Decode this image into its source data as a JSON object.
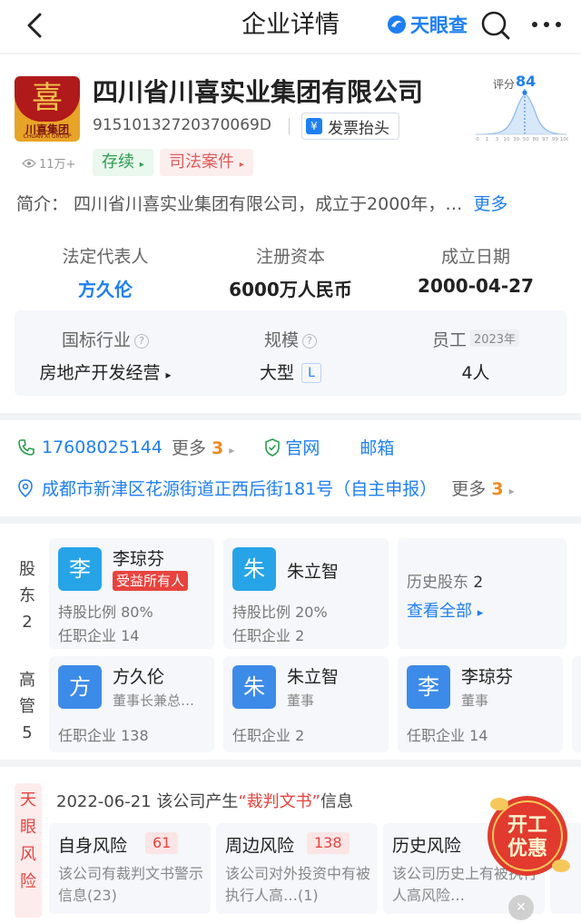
{
  "header": {
    "title": "企业详情",
    "brand": "天眼查"
  },
  "company": {
    "logo_text": "川喜集团",
    "logo_en": "CHUAN XI GROUP",
    "name": "四川省川喜实业集团有限公司",
    "credit_code": "91510132720370069D",
    "invoice_label": "发票抬头",
    "invoice_icon_glyph": "¥",
    "score_label": "评分",
    "score": 84,
    "score_axis": [
      "0",
      "1",
      "3",
      "10",
      "30",
      "50",
      "80",
      "97",
      "99",
      "100"
    ],
    "views": "11万+",
    "tags": {
      "status": "存续",
      "legal": "司法案件"
    },
    "intro_label": "简介：",
    "intro_text": "四川省川喜实业集团有限公司，成立于2000年，…",
    "intro_more": "更多",
    "stats": {
      "legal_rep_label": "法定代表人",
      "legal_rep": "方久伦",
      "capital_label": "注册资本",
      "capital": "6000万人民币",
      "founded_label": "成立日期",
      "founded": "2000-04-27"
    },
    "industry": {
      "industry_label": "国标行业",
      "industry": "房地产开发经营",
      "scale_label": "规模",
      "scale": "大型",
      "scale_badge": "L",
      "staff_label": "员工",
      "staff_year": "2023年",
      "staff": "4人"
    }
  },
  "contact": {
    "phone": "17608025144",
    "phone_more": "更多",
    "phone_more_count": "3",
    "website": "官网",
    "email": "邮箱",
    "address": "成都市新津区花源街道正西后街181号（自主申报）",
    "address_more": "更多",
    "address_more_count": "3"
  },
  "shareholders": {
    "label": "股东",
    "count": "2",
    "items": [
      {
        "avatar": "李",
        "name": "李琼芬",
        "badge": "受益所有人",
        "ratio": "持股比例 80%",
        "jobs": "任职企业 14"
      },
      {
        "avatar": "朱",
        "name": "朱立智",
        "ratio": "持股比例 20%",
        "jobs": "任职企业 2"
      }
    ],
    "history_label": "历史股东",
    "history_count": "2",
    "view_all": "查看全部"
  },
  "executives": {
    "label": "高管",
    "count": "5",
    "items": [
      {
        "avatar": "方",
        "name": "方久伦",
        "role": "董事长兼总…",
        "jobs": "任职企业 138"
      },
      {
        "avatar": "朱",
        "name": "朱立智",
        "role": "董事",
        "jobs": "任职企业 2"
      },
      {
        "avatar": "李",
        "name": "李琼芬",
        "role": "董事",
        "jobs": "任职企业 14"
      }
    ]
  },
  "risk": {
    "side_label": "天眼风险",
    "headline_date": "2022-06-21",
    "headline_pre": "该公司产生",
    "headline_quoted": "“裁判文书”",
    "headline_post": "信息",
    "cards": [
      {
        "title": "自身风险",
        "count": "61",
        "desc": "该公司有裁判文书警示信息(23)"
      },
      {
        "title": "周边风险",
        "count": "138",
        "desc": "该公司对外投资中有被执行人高…(1)"
      },
      {
        "title": "历史风险",
        "count": "",
        "desc": "该公司历史上有被执行人高风险…"
      }
    ],
    "promo_line1": "开工",
    "promo_line2": "优惠"
  },
  "colors": {
    "accent": "#1f7ff2",
    "danger": "#e8433e",
    "success": "#2a9d4c",
    "warning": "#f08a24"
  }
}
